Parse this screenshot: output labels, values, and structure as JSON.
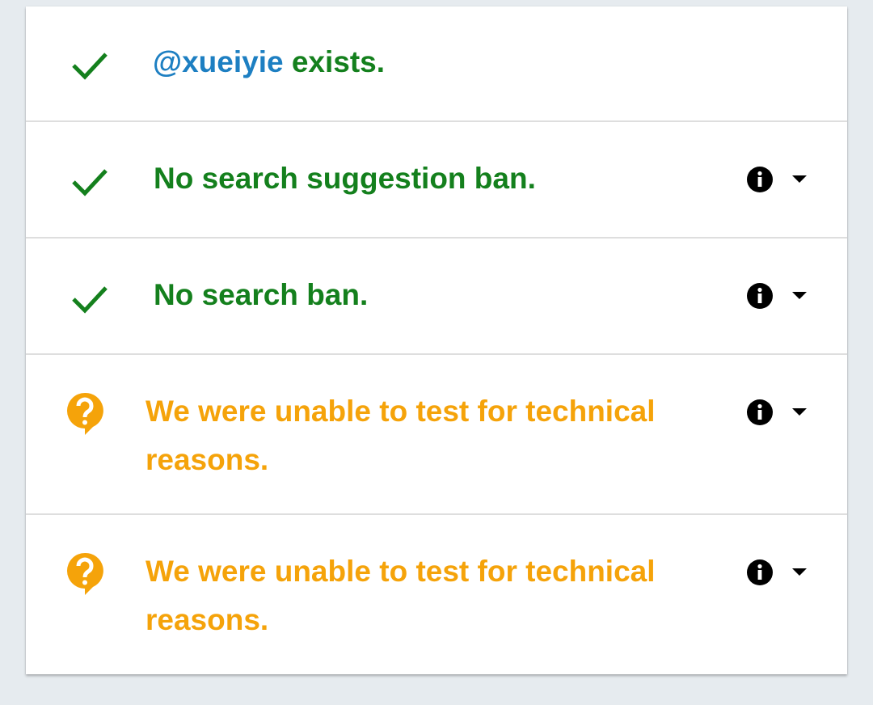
{
  "results": [
    {
      "status": "ok",
      "handle": "@xueiyie",
      "text": " exists.",
      "has_info": false
    },
    {
      "status": "ok",
      "text": "No search suggestion ban.",
      "has_info": true
    },
    {
      "status": "ok",
      "text": "No search ban.",
      "has_info": true
    },
    {
      "status": "unknown",
      "text": "We were unable to test for technical reasons.",
      "has_info": true
    },
    {
      "status": "unknown",
      "text": "We were unable to test for technical reasons.",
      "has_info": true
    }
  ],
  "colors": {
    "ok": "#14801d",
    "link": "#1d7fc2",
    "unknown": "#f5a30a",
    "background": "#e6ebef",
    "card": "#ffffff",
    "divider": "#dedede"
  },
  "icons": {
    "ok": "checkmark-icon",
    "unknown": "question-bubble-icon",
    "info": "info-icon",
    "expand": "caret-down-icon"
  }
}
